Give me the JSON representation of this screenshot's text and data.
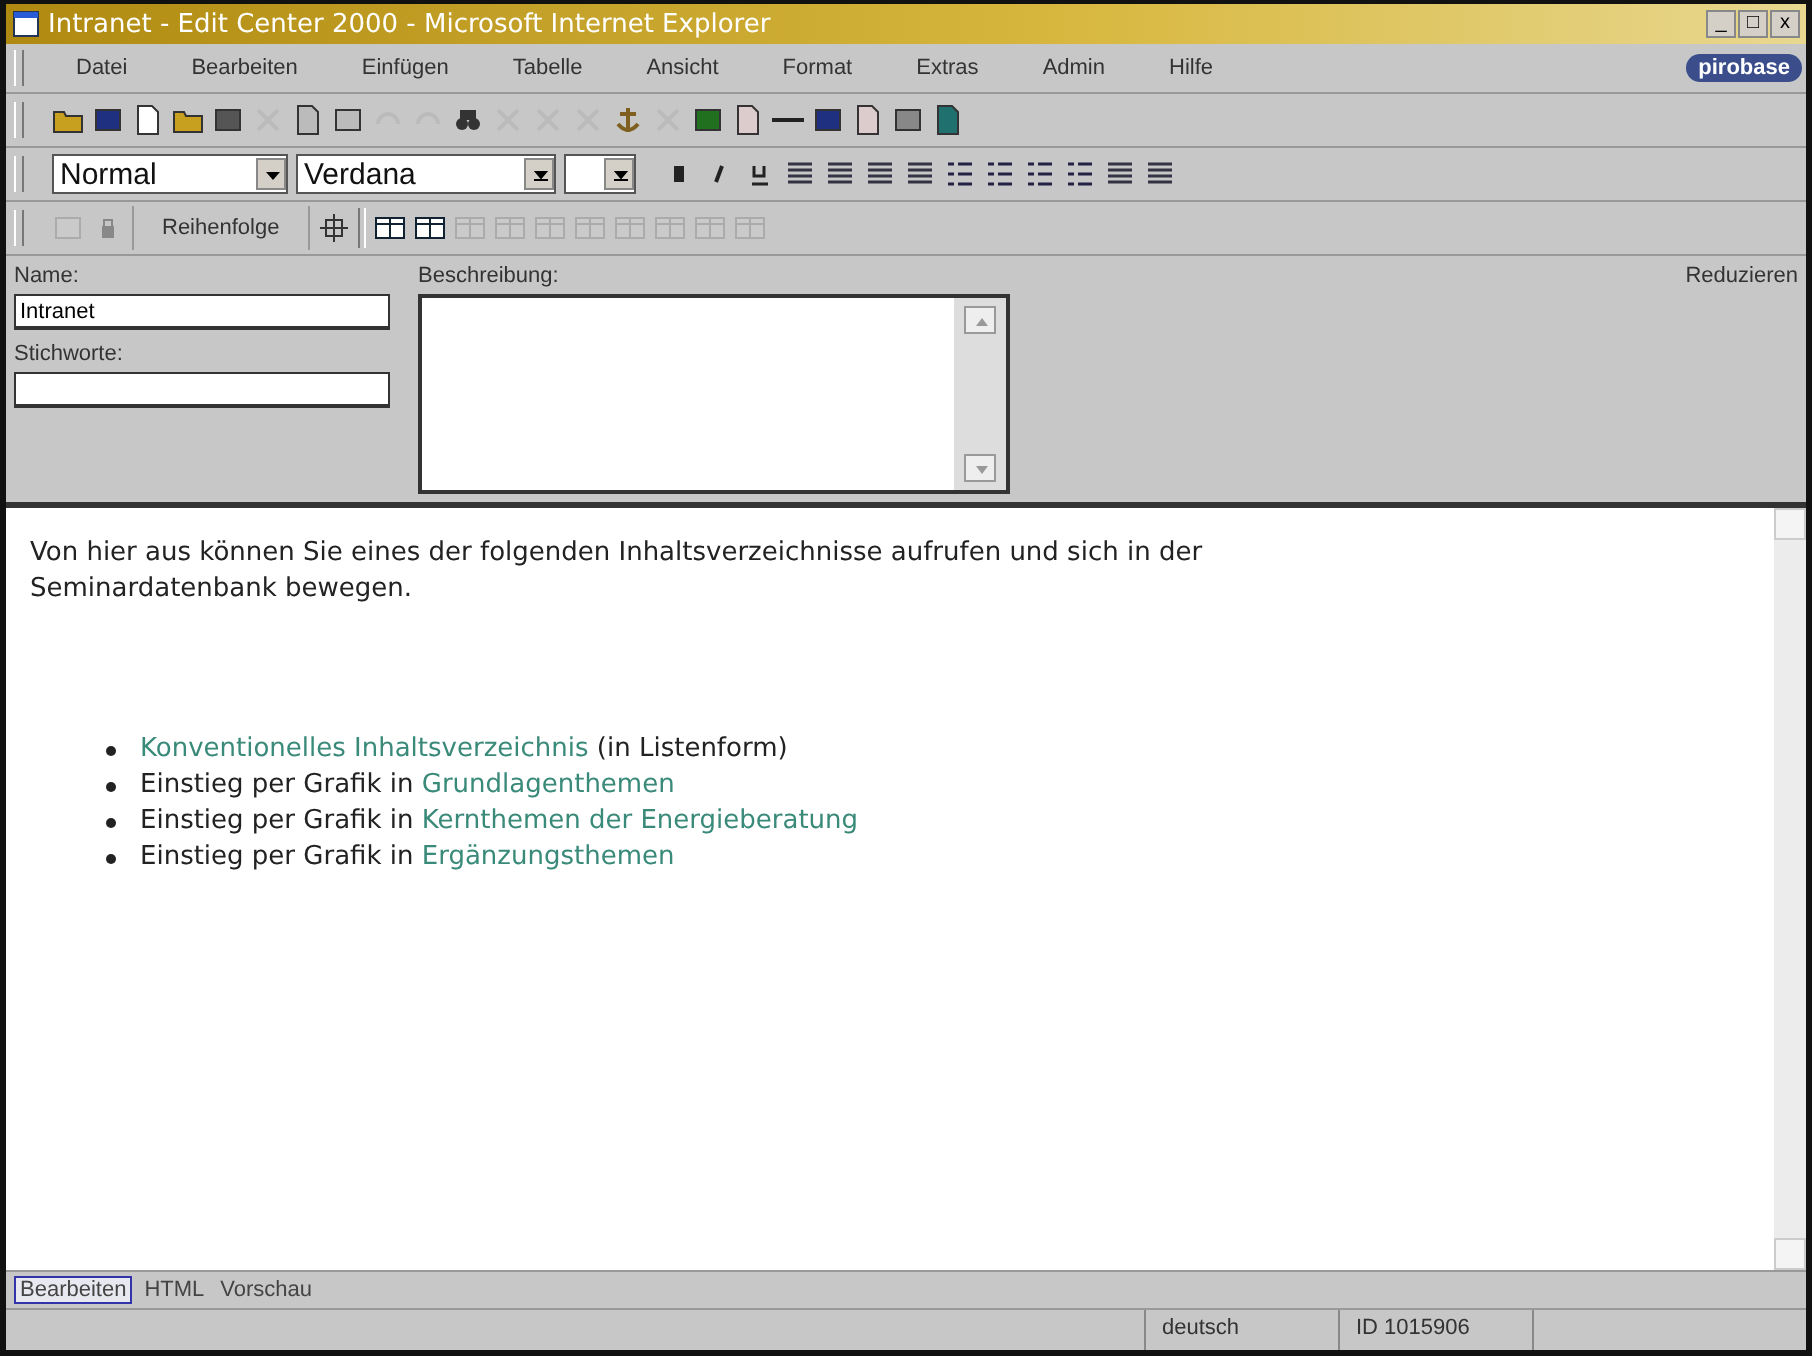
{
  "window": {
    "title": "Intranet - Edit Center 2000 - Microsoft Internet Explorer",
    "controls": [
      "_",
      "□",
      "x"
    ]
  },
  "menu": [
    "Datei",
    "Bearbeiten",
    "Einfügen",
    "Tabelle",
    "Ansicht",
    "Format",
    "Extras",
    "Admin",
    "Hilfe"
  ],
  "logo": "pirobase",
  "format_bar": {
    "style": "Normal",
    "font": "Verdana"
  },
  "table_bar": {
    "button": "Reihenfolge"
  },
  "form": {
    "name_label": "Name:",
    "name_value": "Intranet",
    "keywords_label": "Stichworte:",
    "description_label": "Beschreibung:",
    "collapse": "Reduzieren"
  },
  "content": {
    "intro": "Von hier aus können Sie eines der folgenden Inhaltsverzeichnisse aufrufen und sich in der Seminardatenbank bewegen.",
    "items": [
      {
        "link": "Konventionelles Inhaltsverzeichnis",
        "after": " (in Listenform)"
      },
      {
        "before": "Einstieg per Grafik in ",
        "link": "Grundlagenthemen"
      },
      {
        "before": "Einstieg per Grafik in ",
        "link": "Kernthemen der Energieberatung"
      },
      {
        "before": "Einstieg per Grafik in ",
        "link": "Ergänzungsthemen"
      }
    ]
  },
  "view_tabs": [
    {
      "label": "Bearbeiten",
      "selected": true
    },
    {
      "label": "HTML",
      "selected": false
    },
    {
      "label": "Vorschau",
      "selected": false
    }
  ],
  "status_bar": {
    "language": "deutsch",
    "id": "ID 1015906"
  }
}
